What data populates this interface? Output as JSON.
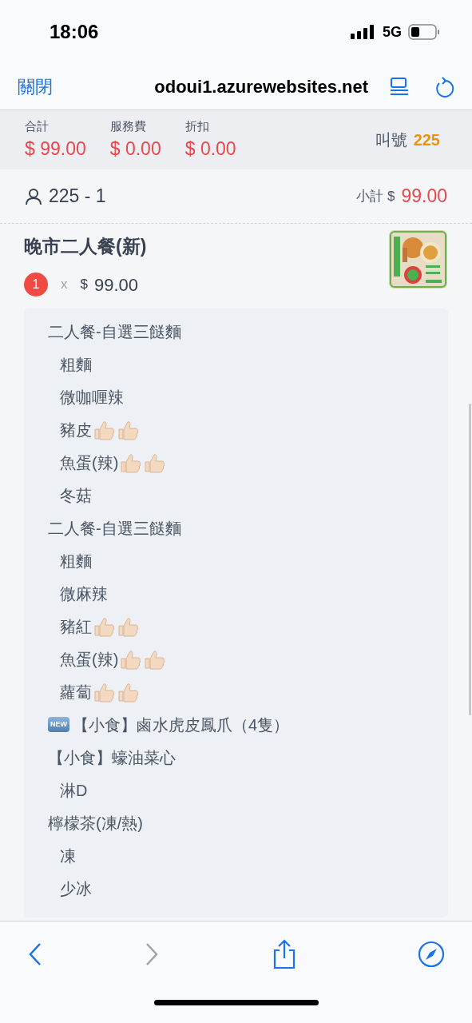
{
  "status_bar": {
    "time": "18:06",
    "network": "5G"
  },
  "browser": {
    "close": "關閉",
    "url": "odoui1.azurewebsites.net"
  },
  "summary": {
    "fields": [
      {
        "label": "合計",
        "value": "$ 99.00"
      },
      {
        "label": "服務費",
        "value": "$ 0.00"
      },
      {
        "label": "折扣",
        "value": "$ 0.00"
      }
    ],
    "call_label": "叫號",
    "call_number": "225"
  },
  "order": {
    "guest": "225 - 1",
    "subtotal_label": "小計 $",
    "subtotal": "99.00"
  },
  "item": {
    "name": "晚市二人餐(新)",
    "qty": "1",
    "times": "x",
    "currency": "$",
    "price": "99.00",
    "options": [
      {
        "text": "二人餐-自選三餸麵",
        "children": [
          {
            "text": "粗麵"
          },
          {
            "text": "微咖喱辣"
          },
          {
            "text": "豬皮",
            "thumbs_up": true
          },
          {
            "text": "魚蛋(辣)",
            "thumbs_up": true
          },
          {
            "text": "冬菇"
          }
        ]
      },
      {
        "text": "二人餐-自選三餸麵",
        "children": [
          {
            "text": "粗麵"
          },
          {
            "text": "微麻辣"
          },
          {
            "text": "豬紅",
            "thumbs_up": true
          },
          {
            "text": "魚蛋(辣)",
            "thumbs_up": true
          },
          {
            "text": "蘿蔔",
            "thumbs_up": true
          }
        ]
      },
      {
        "text": "【小食】鹵水虎皮鳳爪（4隻）",
        "badge": "NEW"
      },
      {
        "text": "【小食】蠔油菜心",
        "children": [
          {
            "text": "淋D"
          }
        ]
      },
      {
        "text": "檸檬茶(凍/熱)",
        "children": [
          {
            "text": "凍"
          },
          {
            "text": "少冰"
          }
        ]
      }
    ]
  }
}
